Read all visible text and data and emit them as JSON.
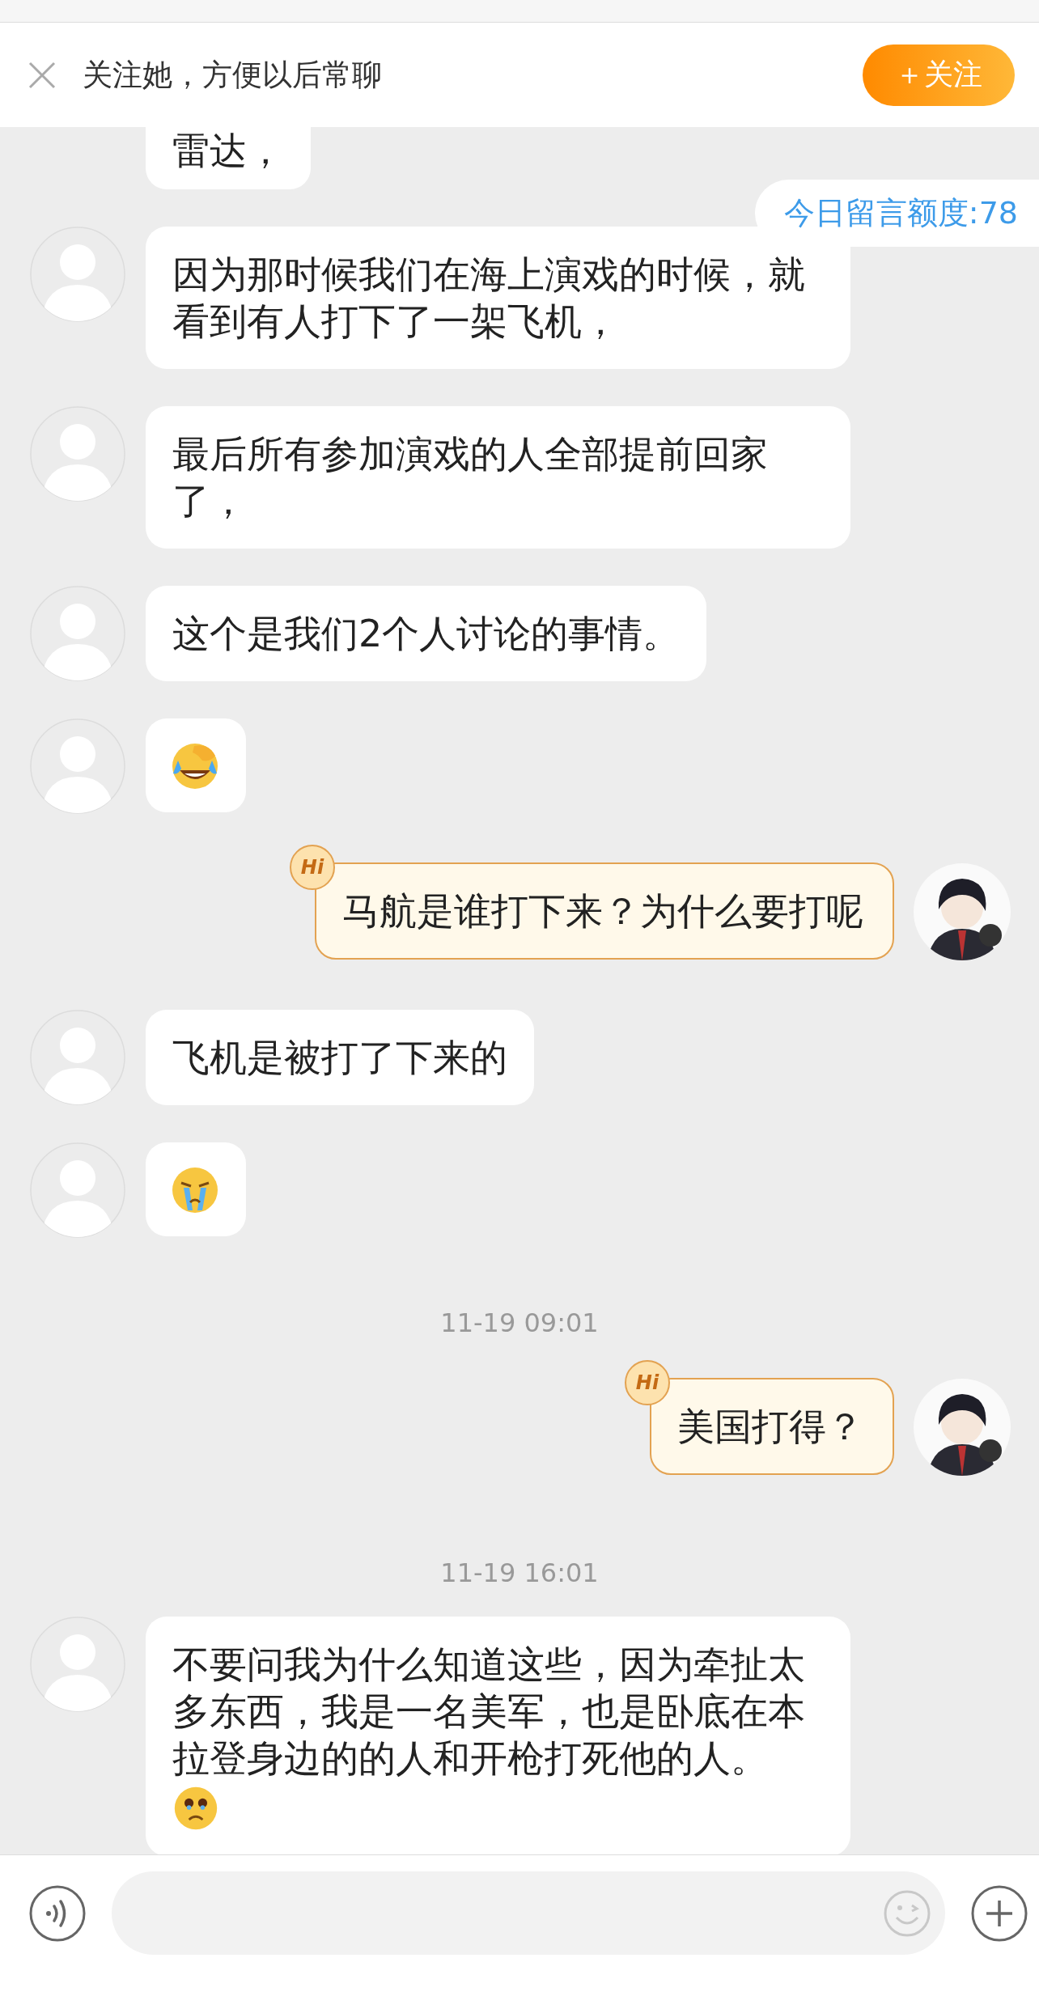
{
  "banner": {
    "text": "关注她，方便以后常聊",
    "follow_button": "＋关注"
  },
  "quota": "今日留言额度:78",
  "messages": [
    {
      "kind": "received",
      "text": "雷达，"
    },
    {
      "kind": "received",
      "text": "因为那时候我们在海上演戏的时候，就看到有人打下了一架飞机，"
    },
    {
      "kind": "received",
      "text": "最后所有参加演戏的人全部提前回家了，"
    },
    {
      "kind": "received",
      "text": "这个是我们2个人讨论的事情。"
    },
    {
      "kind": "received",
      "sticker": {
        "kind": "laughing"
      }
    },
    {
      "kind": "sent",
      "badge": "Hi",
      "text": "马航是谁打下来？为什么要打呢"
    },
    {
      "kind": "received",
      "text": "飞机是被打了下来的"
    },
    {
      "kind": "received",
      "sticker": {
        "kind": "crying"
      }
    },
    {
      "kind": "timestamp",
      "text": "11-19 09:01"
    },
    {
      "kind": "sent",
      "badge": "Hi",
      "text": "美国打得？"
    },
    {
      "kind": "timestamp",
      "text": "11-19 16:01"
    },
    {
      "kind": "received",
      "text": "不要问我为什么知道这些，因为牵扯太多东西，我是一名美军，也是卧底在本拉登身边的的人和开枪打死他的人。",
      "sticker": {
        "kind": "teary"
      }
    }
  ]
}
